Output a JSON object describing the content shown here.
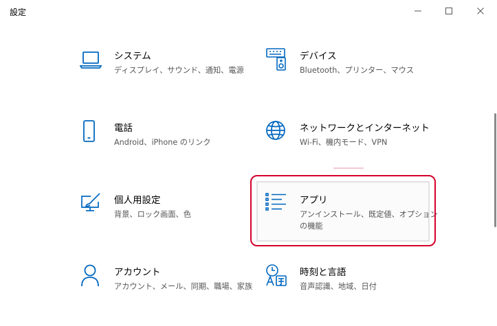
{
  "window": {
    "title": "設定"
  },
  "colors": {
    "accent": "#0067c0",
    "highlight": "#d4002a"
  },
  "tiles": [
    {
      "id": "system",
      "icon": "laptop-icon",
      "name": "システム",
      "desc": "ディスプレイ、サウンド、通知、電源"
    },
    {
      "id": "devices",
      "icon": "keyboard-speaker-icon",
      "name": "デバイス",
      "desc": "Bluetooth、プリンター、マウス"
    },
    {
      "id": "phone",
      "icon": "phone-icon",
      "name": "電話",
      "desc": "Android、iPhone のリンク"
    },
    {
      "id": "network",
      "icon": "globe-icon",
      "name": "ネットワークとインターネット",
      "desc": "Wi-Fi、機内モード、VPN"
    },
    {
      "id": "personalization",
      "icon": "paint-monitor-icon",
      "name": "個人用設定",
      "desc": "背景、ロック画面、色"
    },
    {
      "id": "apps",
      "icon": "app-list-icon",
      "name": "アプリ",
      "desc": "アンインストール、既定値、オプションの機能"
    },
    {
      "id": "accounts",
      "icon": "person-icon",
      "name": "アカウント",
      "desc": "アカウント、メール、同期、職場、家族"
    },
    {
      "id": "time-language",
      "icon": "time-language-icon",
      "name": "時刻と言語",
      "desc": "音声認識、地域、日付"
    }
  ]
}
